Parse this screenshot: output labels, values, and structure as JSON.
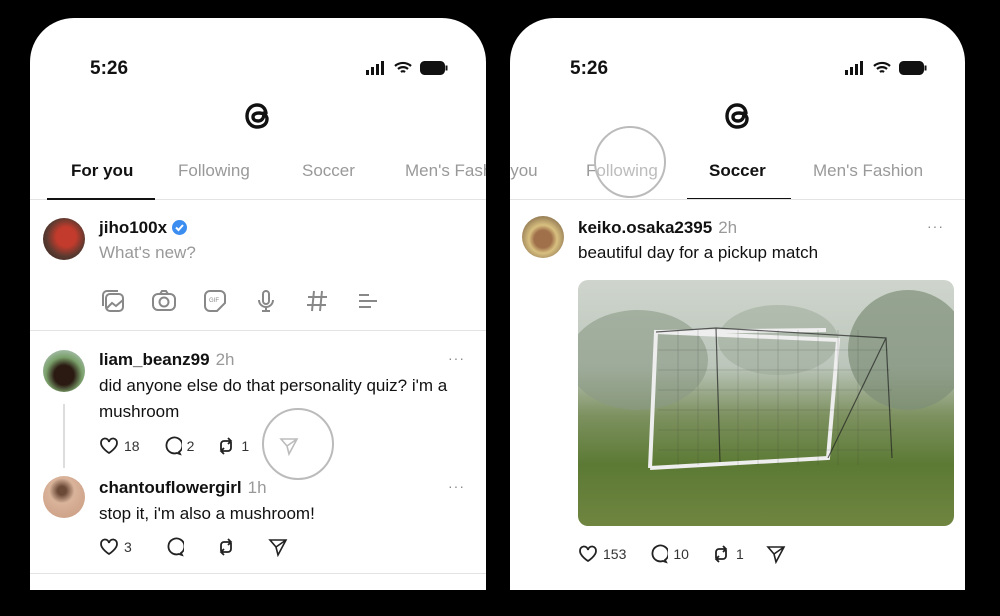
{
  "left": {
    "time": "5:26",
    "tabs": [
      "For you",
      "Following",
      "Soccer",
      "Men's Fashion"
    ],
    "composer": {
      "username": "jiho100x",
      "verified": true,
      "placeholder": "What's new?",
      "tools": [
        "gallery-icon",
        "camera-icon",
        "gif-icon",
        "mic-icon",
        "hashtag-icon",
        "poll-icon"
      ]
    },
    "posts": [
      {
        "username": "liam_beanz99",
        "time": "2h",
        "text": "did anyone else do that personality quiz? i'm a mushroom",
        "likes": "18",
        "replies": "2",
        "reposts": "1"
      },
      {
        "username": "chantouflowergirl",
        "time": "1h",
        "text": "stop it, i'm also a mushroom!",
        "likes": "3"
      }
    ]
  },
  "right": {
    "time": "5:26",
    "tabs": [
      "For you",
      "Following",
      "Soccer",
      "Men's Fashion"
    ],
    "active_tab": "Soccer",
    "post": {
      "username": "keiko.osaka2395",
      "time": "2h",
      "text": "beautiful day for a pickup match",
      "likes": "153",
      "replies": "10",
      "reposts": "1"
    }
  },
  "colors": {
    "verified": "#3b8df0",
    "muted": "#999999"
  }
}
